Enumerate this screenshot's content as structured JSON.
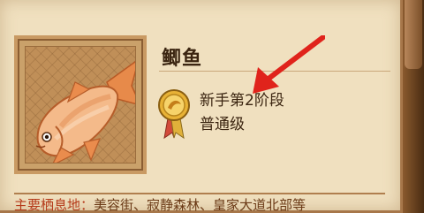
{
  "item": {
    "name": "鲫鱼",
    "stage": "新手第2阶段",
    "grade": "普通级"
  },
  "habitat": {
    "label": "主要栖息地：",
    "locations": "美容街、寂静森林、皇家大道北部等"
  },
  "icons": {
    "fish": "carp-fish-icon",
    "badge": "gold-medal-badge-icon",
    "arrow": "red-pointer-arrow"
  },
  "colors": {
    "panel": "#f0e0bf",
    "frame": "#c99a63",
    "text": "#3b2511",
    "habitat_label": "#b53a1a",
    "arrow": "#e0231b"
  }
}
